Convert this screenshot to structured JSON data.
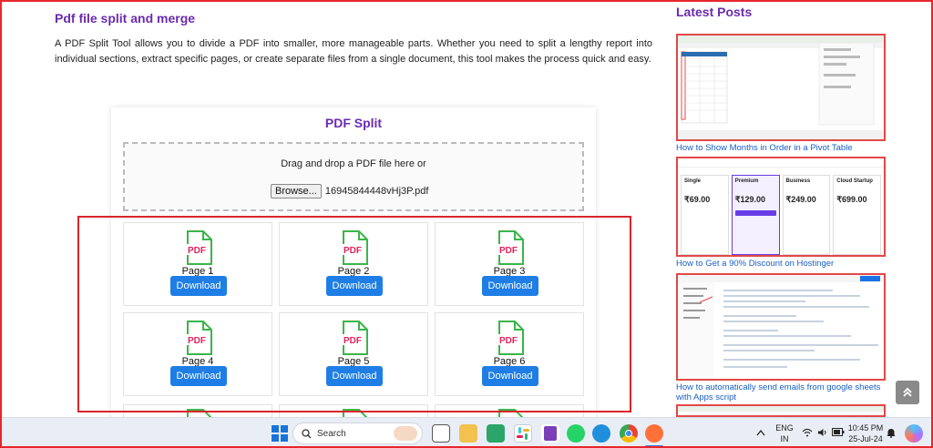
{
  "article": {
    "title": "Pdf file split and merge",
    "paragraph": "A PDF Split Tool allows you to divide a PDF into smaller, more manageable parts. Whether you need to split a lengthy report into individual sections, extract specific pages, or create separate files from a single document, this tool makes the process quick and easy."
  },
  "tool": {
    "title": "PDF Split",
    "drop_text": "Drag and drop a PDF file here or",
    "browse_label": "Browse...",
    "file_name": "16945844448vHj3P.pdf",
    "icon_text": "PDF",
    "download_label": "Download",
    "pages": [
      {
        "label": "Page 1"
      },
      {
        "label": "Page 2"
      },
      {
        "label": "Page 3"
      },
      {
        "label": "Page 4"
      },
      {
        "label": "Page 5"
      },
      {
        "label": "Page 6"
      }
    ]
  },
  "sidebar": {
    "title": "Latest Posts",
    "posts": [
      {
        "title": "How to Show Months in Order in a Pivot Table"
      },
      {
        "title": "How to Get a 90% Discount on Hostinger"
      },
      {
        "title": "How to automatically send emails from google sheets with Apps script"
      }
    ],
    "hosting_plans": [
      {
        "name": "Single",
        "price": "₹69.00"
      },
      {
        "name": "Premium",
        "price": "₹129.00"
      },
      {
        "name": "Business",
        "price": "₹249.00"
      },
      {
        "name": "Cloud Startup",
        "price": "₹699.00"
      }
    ]
  },
  "taskbar": {
    "search_placeholder": "Search",
    "lang_top": "ENG",
    "lang_bottom": "IN",
    "time": "10:45 PM",
    "date": "25-Jul-24"
  },
  "colors": {
    "accent_purple": "#6a2bb0",
    "download_blue": "#1e7ee6",
    "highlight_red": "#d9252a",
    "pdf_green": "#3bb54a",
    "pdf_red": "#e0245e"
  },
  "scroll_top_icon": "double-chevron-up-icon"
}
